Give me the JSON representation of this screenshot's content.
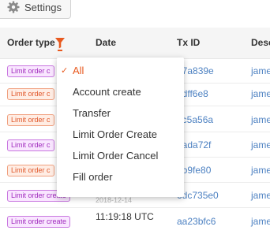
{
  "toolbar": {
    "settings_label": "Settings",
    "settings_icon": "gear-icon"
  },
  "table": {
    "columns": {
      "order_type": "Order type",
      "date": "Date",
      "tx_id": "Tx ID",
      "description": "Desc"
    },
    "filter_icon": "funnel-icon",
    "rows": [
      {
        "order_type": "Limit order c",
        "tag_color": "purple",
        "tx_id": "87a839e",
        "description": "jame"
      },
      {
        "order_type": "Limit order c",
        "tag_color": "orange",
        "tx_id": "1dff6e8",
        "description": "jame"
      },
      {
        "order_type": "Limit order c",
        "tag_color": "orange",
        "tx_id": "dc5a56a",
        "description": "jame"
      },
      {
        "order_type": "Limit order c",
        "tag_color": "purple",
        "tx_id": "0ada72f",
        "description": "jame"
      },
      {
        "order_type": "Limit order c",
        "tag_color": "orange",
        "tx_id": "2b9fe80",
        "description": "jame"
      },
      {
        "order_type": "Limit order create",
        "tag_color": "purple",
        "date": "2018-12-14",
        "tx_id": "6dc735e0",
        "description": "jame"
      },
      {
        "order_type": "Limit order create",
        "tag_color": "purple",
        "time": "11:19:18 UTC",
        "tx_id": "aa23bfc6",
        "description": "jame"
      }
    ]
  },
  "filter_dropdown": {
    "selected": "All",
    "options": [
      "All",
      "Account create",
      "Transfer",
      "Limit Order Create",
      "Limit Order Cancel",
      "Fill order"
    ]
  },
  "colors": {
    "accent": "#e85a1f",
    "link": "#4e82c2",
    "purple_tag_text": "#a02bbd",
    "orange_tag_text": "#e0582c"
  }
}
